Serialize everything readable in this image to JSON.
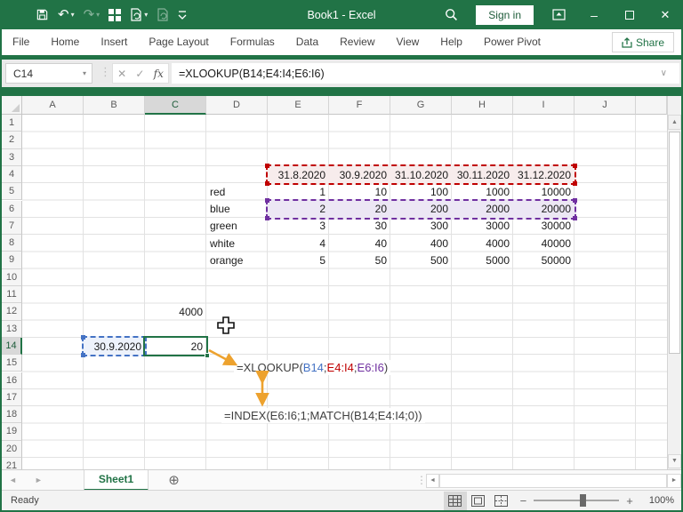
{
  "window": {
    "title": "Book1 - Excel"
  },
  "titlebar": {
    "sign_in_label": "Sign in",
    "qat_icons": [
      "save-icon",
      "undo-icon",
      "redo-icon",
      "switch-windows-icon",
      "paste-preview-icon",
      "document-icon",
      "customize-qat-icon"
    ]
  },
  "ribbon": {
    "tabs": [
      "File",
      "Home",
      "Insert",
      "Page Layout",
      "Formulas",
      "Data",
      "Review",
      "View",
      "Help",
      "Power Pivot"
    ],
    "share_label": "Share"
  },
  "formula_bar": {
    "name_box": "C14",
    "fx_label": "fx",
    "formula": "=XLOOKUP(B14;E4:I4;E6:I6)"
  },
  "sheet": {
    "columns": [
      "A",
      "B",
      "C",
      "D",
      "E",
      "F",
      "G",
      "H",
      "I",
      "J"
    ],
    "row_count": 21,
    "selected_column": "C",
    "selected_row": 14,
    "dates_range": "E4:I4",
    "dates": [
      "31.8.2020",
      "30.9.2020",
      "31.10.2020",
      "30.11.2020",
      "31.12.2020"
    ],
    "series": [
      {
        "label": "red",
        "values": [
          "1",
          "10",
          "100",
          "1000",
          "10000"
        ]
      },
      {
        "label": "blue",
        "values": [
          "2",
          "20",
          "200",
          "2000",
          "20000"
        ]
      },
      {
        "label": "green",
        "values": [
          "3",
          "30",
          "300",
          "3000",
          "30000"
        ]
      },
      {
        "label": "white",
        "values": [
          "4",
          "40",
          "400",
          "4000",
          "40000"
        ]
      },
      {
        "label": "orange",
        "values": [
          "5",
          "50",
          "500",
          "5000",
          "50000"
        ]
      }
    ],
    "highlighted_series_range": "E6:I6",
    "result_cell": {
      "ref": "C12",
      "value": "4000"
    },
    "lookup_cell": {
      "ref": "B14",
      "value": "30.9.2020"
    },
    "active_cell": {
      "ref": "C14",
      "value": "20"
    }
  },
  "annotations": {
    "xlookup_parts": [
      {
        "text": "=XLOOKUP(",
        "color": "#3f3f3f"
      },
      {
        "text": "B14",
        "color": "#4472c4"
      },
      {
        "text": ";",
        "color": "#3f3f3f"
      },
      {
        "text": "E4:I4",
        "color": "#c00000"
      },
      {
        "text": ";",
        "color": "#3f3f3f"
      },
      {
        "text": "E6:I6",
        "color": "#7030a0"
      },
      {
        "text": ")",
        "color": "#3f3f3f"
      }
    ],
    "index_formula": "=INDEX(E6:I6;1;MATCH(B14;E4:I4;0))"
  },
  "colors": {
    "excel_green": "#217346",
    "range_red": "#c00000",
    "range_red_fill": "#f7ecec",
    "range_purple": "#7030a0",
    "range_purple_fill": "#ece7f4",
    "range_blue": "#4472c4",
    "range_blue_fill": "#edf2fb",
    "arrow_orange": "#eda22e"
  },
  "icons": {
    "cancel": "✕",
    "enter": "✓",
    "dropdown_caret": "▾",
    "formula_expand": "∨",
    "separator_dots": "⋮",
    "nav_left": "◄",
    "nav_right": "►",
    "scroll_up": "▲",
    "scroll_down": "▼",
    "add_sheet": "⊕",
    "minimize": "–",
    "close": "✕",
    "zoom_out": "−",
    "zoom_in": "+"
  },
  "tabs_bar": {
    "sheet_name": "Sheet1"
  },
  "status_bar": {
    "status": "Ready",
    "zoom_level": "100%"
  }
}
